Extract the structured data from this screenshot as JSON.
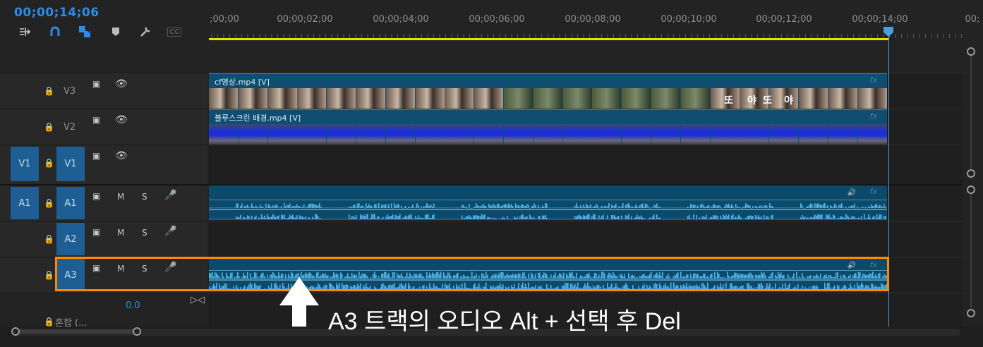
{
  "timeline": {
    "timecode": "00;00;14;06",
    "ruler_labels": [
      ";00;00",
      "00;00;02;00",
      "00;00;04;00",
      "00;00;06;00",
      "00;00;08;00",
      "00;00;10;00",
      "00;00;12;00",
      "00;00;14;00",
      "00;"
    ]
  },
  "toolbar": {
    "icons": [
      "insert-nested-sequence-icon",
      "snap-magnet-icon",
      "linked-selection-icon",
      "add-marker-icon",
      "timeline-settings-wrench-icon",
      "captions-icon"
    ],
    "cc_label": "CC"
  },
  "tracks": {
    "v3": {
      "name": "V3"
    },
    "v2": {
      "name": "V2"
    },
    "v1": {
      "source": "V1",
      "name": "V1"
    },
    "a1": {
      "source": "A1",
      "name": "A1",
      "m": "M",
      "s": "S"
    },
    "a2": {
      "name": "A2",
      "m": "M",
      "s": "S"
    },
    "a3": {
      "name": "A3",
      "m": "M",
      "s": "S"
    },
    "mix": {
      "label": "혼합 (...",
      "volume": "0.0"
    }
  },
  "clips": {
    "v3": {
      "label": "cf영상.mp4 [V]",
      "overlay_text": [
        "또",
        "야",
        "또",
        "야"
      ]
    },
    "v2": {
      "label": "블루스크린 배경.mp4 [V]"
    },
    "fx": "fx"
  },
  "annotation": {
    "text": "A3 트랙의 오디오 Alt + 선택 후 Del",
    "highlight_color": "#ff8a00"
  },
  "colors": {
    "playhead": "#4a9fde",
    "timecode": "#2d8ceb",
    "track_target": "#1d5f94",
    "work_area": "#e5e100",
    "waveform": "#52b6e8"
  }
}
